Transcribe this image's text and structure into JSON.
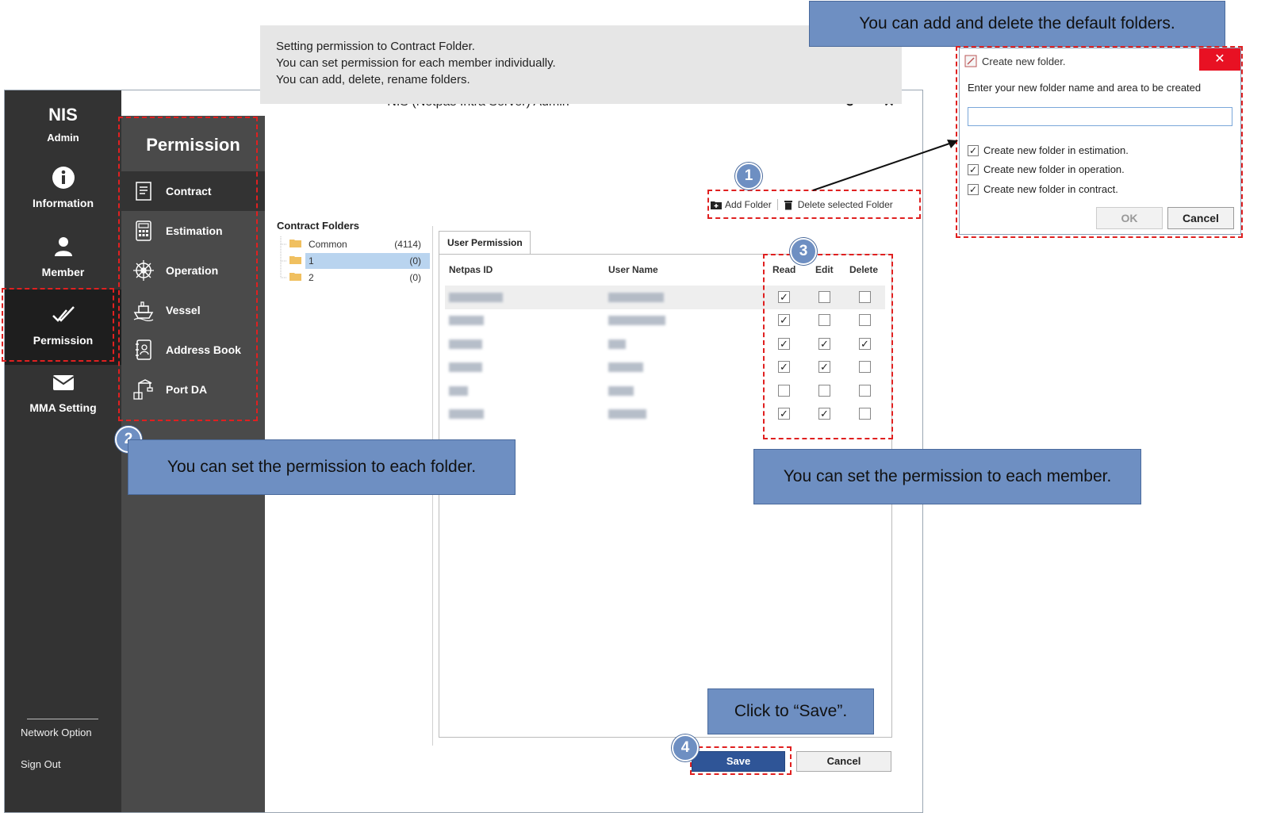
{
  "window": {
    "title": "NIS (Netpas Intra Server) Admin"
  },
  "nav": {
    "brand": "NIS",
    "brand_sub": "Admin",
    "items": [
      {
        "label": "Information",
        "icon": "info-icon"
      },
      {
        "label": "Member",
        "icon": "person-icon"
      },
      {
        "label": "Permission",
        "icon": "double-check-icon"
      },
      {
        "label": "MMA Setting",
        "icon": "mail-icon"
      }
    ],
    "network_option": "Network Option",
    "sign_out": "Sign Out"
  },
  "submenu": {
    "title": "Permission",
    "items": [
      {
        "label": "Contract",
        "icon": "contract-icon"
      },
      {
        "label": "Estimation",
        "icon": "calculator-icon"
      },
      {
        "label": "Operation",
        "icon": "ship-wheel-icon"
      },
      {
        "label": "Vessel",
        "icon": "ship-icon"
      },
      {
        "label": "Address Book",
        "icon": "address-book-icon"
      },
      {
        "label": "Port DA",
        "icon": "port-crane-icon"
      }
    ]
  },
  "info": {
    "line1": "Setting permission to Contract Folder.",
    "line2": "You can set permission for each member individually.",
    "line3": "You can add, delete, rename folders."
  },
  "toolbar": {
    "add_folder": "Add Folder",
    "delete_folder": "Delete selected Folder"
  },
  "folders": {
    "title": "Contract Folders",
    "items": [
      {
        "name": "Common",
        "count": "(4114)"
      },
      {
        "name": "1",
        "count": "(0)"
      },
      {
        "name": "2",
        "count": "(0)"
      }
    ]
  },
  "permission": {
    "tab": "User Permission",
    "columns": {
      "id": "Netpas ID",
      "name": "User Name",
      "read": "Read",
      "edit": "Edit",
      "delete": "Delete"
    },
    "rows": [
      {
        "read": true,
        "edit": false,
        "delete": false
      },
      {
        "read": true,
        "edit": false,
        "delete": false
      },
      {
        "read": true,
        "edit": true,
        "delete": true
      },
      {
        "read": true,
        "edit": true,
        "delete": false
      },
      {
        "read": false,
        "edit": false,
        "delete": false
      },
      {
        "read": true,
        "edit": true,
        "delete": false
      }
    ]
  },
  "buttons": {
    "save": "Save",
    "cancel": "Cancel"
  },
  "callouts": {
    "top": "You can add and delete the default folders.",
    "folder": "You can set the permission to each folder.",
    "member": "You can set the permission to each member.",
    "save": "Click to “Save”."
  },
  "numbers": [
    "1",
    "2",
    "3",
    "4"
  ],
  "dialog": {
    "title": "Create new folder.",
    "prompt": "Enter your new folder name and area to be created",
    "input_value": "",
    "checks": [
      "Create new folder in estimation.",
      "Create new folder in operation.",
      "Create new folder in contract."
    ],
    "ok": "OK",
    "cancel": "Cancel",
    "close": "✕"
  },
  "colors": {
    "nav_bg": "#333333",
    "submenu_bg": "#4a4a4a",
    "callout": "#6e8fc2",
    "annotation_dash": "#e02020",
    "save_button": "#2f5597"
  }
}
